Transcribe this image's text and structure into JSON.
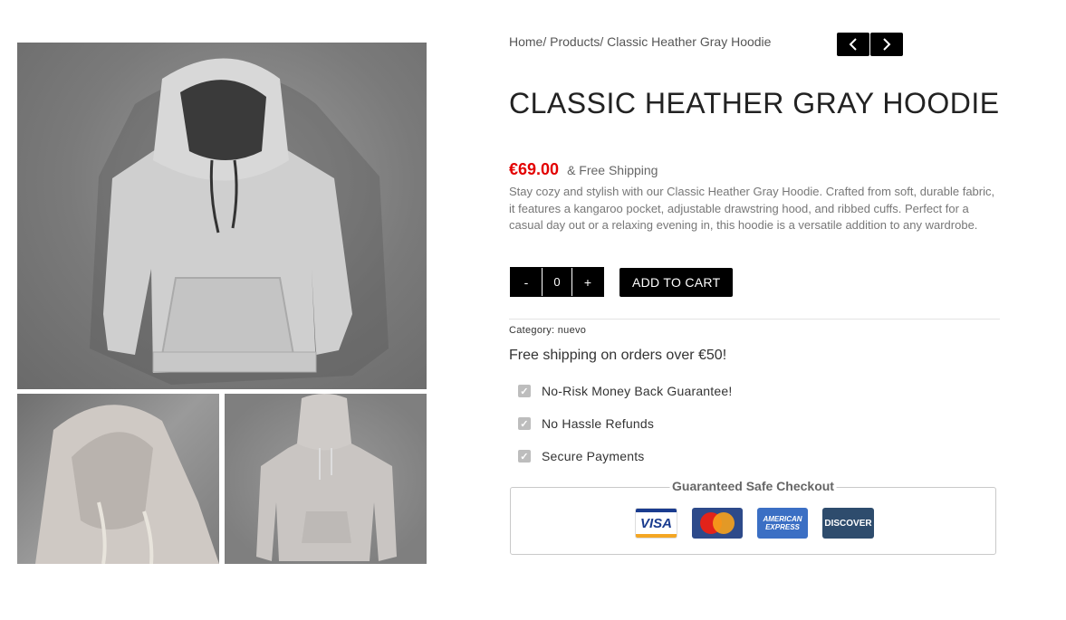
{
  "breadcrumb": "Home/ Products/ Classic Heather Gray Hoodie",
  "nav": {
    "prev_icon": "chevron-left-icon",
    "next_icon": "chevron-right-icon"
  },
  "product": {
    "title": "CLASSIC HEATHER GRAY HOODIE",
    "price": "€69.00",
    "shipping_note": "& Free Shipping",
    "description": "Stay cozy and stylish with our Classic Heather Gray Hoodie. Crafted from soft, durable fabric, it features a kangaroo pocket, adjustable drawstring hood, and ribbed cuffs. Perfect for a casual day out or a relaxing evening in, this hoodie is a versatile addition to any wardrobe.",
    "category_label": "Category:",
    "category": "nuevo"
  },
  "cart": {
    "minus": "-",
    "qty": "0",
    "plus": "+",
    "add_label": "ADD TO CART"
  },
  "free_shipping": "Free shipping on orders over €50!",
  "features": [
    {
      "label": "No-Risk Money Back Guarantee!"
    },
    {
      "label": "No Hassle Refunds"
    },
    {
      "label": "Secure Payments"
    }
  ],
  "checkout": {
    "legend": "Guaranteed Safe Checkout",
    "cards": [
      {
        "name": "VISA"
      },
      {
        "name": "MasterCard"
      },
      {
        "name": "AMERICAN EXPRESS"
      },
      {
        "name": "DISCOVER"
      }
    ]
  },
  "colors": {
    "price": "#e30000",
    "button": "#000000",
    "check": "#bdbdbd"
  }
}
